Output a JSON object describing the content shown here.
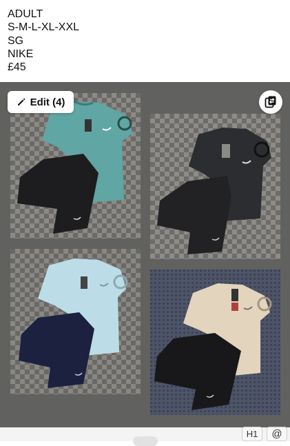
{
  "caption": {
    "lines": [
      "ADULT",
      "S-M-L-XL-XXL",
      "SG",
      "NIKE",
      "£45"
    ]
  },
  "editor": {
    "edit_label": "Edit (4)",
    "edit_icon": "pencil-icon",
    "swap_icon": "swap-order-icon"
  },
  "photos": [
    {
      "name": "teal t-shirt and black shorts",
      "shirt_color": "#5fa6a4",
      "shorts_color": "#1d1d1f",
      "background": "checkered-rug"
    },
    {
      "name": "black t-shirt and black shorts",
      "shirt_color": "#2c2d30",
      "shorts_color": "#222225",
      "background": "checkered-rug"
    },
    {
      "name": "light blue t-shirt and navy shorts",
      "shirt_color": "#bcdde8",
      "shorts_color": "#1c2140",
      "background": "checkered-rug"
    },
    {
      "name": "beige t-shirt and black shorts",
      "shirt_color": "#e3d4bd",
      "shorts_color": "#18181a",
      "background": "blue-rug"
    }
  ],
  "toolbar": {
    "h1_label": "H1",
    "at_label": "@"
  }
}
